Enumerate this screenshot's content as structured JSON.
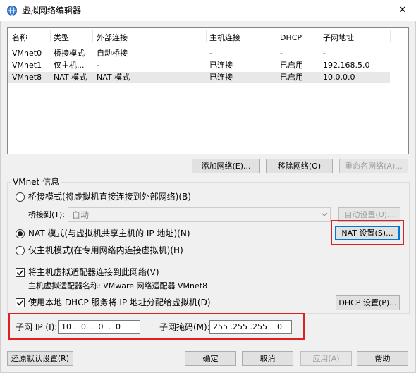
{
  "window": {
    "title": "虚拟网络编辑器",
    "close_glyph": "✕"
  },
  "table": {
    "headers": [
      "名称",
      "类型",
      "外部连接",
      "主机连接",
      "DHCP",
      "子网地址"
    ],
    "rows": [
      [
        "VMnet0",
        "桥接模式",
        "自动桥接",
        "-",
        "-",
        "-"
      ],
      [
        "VMnet1",
        "仅主机...",
        "-",
        "已连接",
        "已启用",
        "192.168.5.0"
      ],
      [
        "VMnet8",
        "NAT 模式",
        "NAT 模式",
        "已连接",
        "已启用",
        "10.0.0.0"
      ]
    ],
    "selected_row": 2
  },
  "table_buttons": {
    "add": "添加网络(E)...",
    "remove": "移除网络(O)",
    "rename": "重命名网络(A)..."
  },
  "vmnet_info": {
    "group_title": "VMnet 信息",
    "bridge_label": "桥接模式(将虚拟机直接连接到外部网络)(B)",
    "bridge_to_label": "桥接到(T):",
    "bridge_to_value": "自动",
    "auto_settings": "自动设置(U)...",
    "nat_label": "NAT 模式(与虚拟机共享主机的 IP 地址)(N)",
    "nat_settings": "NAT 设置(S)...",
    "hostonly_label": "仅主机模式(在专用网络内连接虚拟机)(H)",
    "selected_mode": "nat",
    "connect_adapter_label": "将主机虚拟适配器连接到此网络(V)",
    "connect_adapter_checked": true,
    "adapter_name_label": "主机虚拟适配器名称: VMware 网络适配器 VMnet8",
    "dhcp_label": "使用本地 DHCP 服务将 IP 地址分配给虚拟机(D)",
    "dhcp_checked": true,
    "dhcp_settings": "DHCP 设置(P)...",
    "subnet_ip_label": "子网 IP (I):",
    "subnet_ip_value": "10 .  0  .  0  .  0",
    "subnet_mask_label": "子网掩码(M):",
    "subnet_mask_value": "255 .255 .255 .  0"
  },
  "bottom_buttons": {
    "restore": "还原默认设置(R)",
    "ok": "确定",
    "cancel": "取消",
    "apply": "应用(A)",
    "help": "帮助"
  },
  "colors": {
    "highlight_red": "#e02020",
    "selected_row": "#e8e8e8",
    "accent": "#0078d7"
  }
}
